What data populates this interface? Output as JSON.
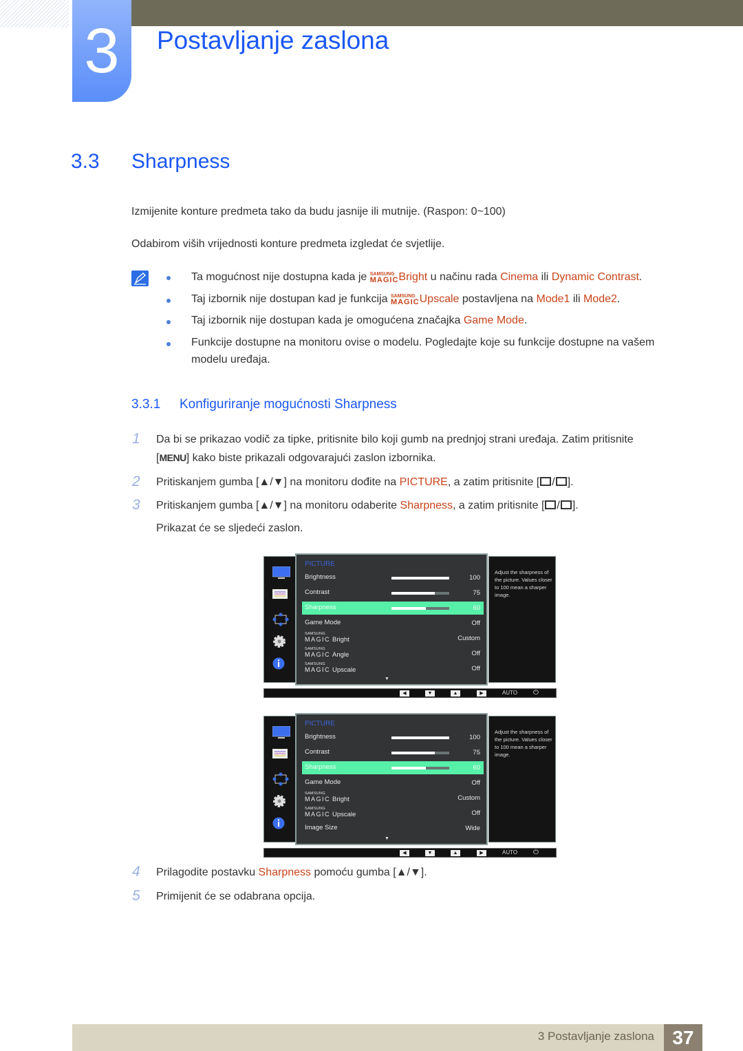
{
  "chapter": {
    "number": "3",
    "title": "Postavljanje zaslona"
  },
  "section": {
    "number": "3.3",
    "title": "Sharpness"
  },
  "intro": [
    "Izmijenite konture predmeta tako da budu jasnije ili mutnije. (Raspon: 0~100)",
    "Odabirom viših vrijednosti konture predmeta izgledat će svjetlije."
  ],
  "magic_logo": {
    "top": "SAMSUNG",
    "bottom": "MAGIC"
  },
  "notes": {
    "n1": {
      "a": "Ta mogućnost nije dostupna kada je ",
      "feature": "Bright",
      "b": " u načinu rada ",
      "c1": "Cinema",
      "d": " ili ",
      "c2": "Dynamic Contrast",
      "e": "."
    },
    "n2": {
      "a": "Taj izbornik nije dostupan kad je funkcija ",
      "feature": "Upscale",
      "b": " postavljena na ",
      "c1": "Mode1",
      "d": " ili ",
      "c2": "Mode2",
      "e": "."
    },
    "n3": {
      "a": "Taj izbornik nije dostupan kada je omogućena značajka ",
      "c1": "Game Mode",
      "e": "."
    },
    "n4": {
      "a": "Funkcije dostupne na monitoru ovise o modelu. Pogledajte koje su funkcije dostupne na vašem",
      "b": "modelu uređaja."
    }
  },
  "subsection": {
    "number": "3.3.1",
    "title": "Konfiguriranje mogućnosti Sharpness"
  },
  "steps": {
    "s1": {
      "num": "1",
      "line1": "Da bi se prikazao vodič za tipke, pritisnite bilo koji gumb na prednjoj strani uređaja. Zatim pritisnite",
      "key": "MENU",
      "line2": "kako biste prikazali odgovarajući zaslon izbornika."
    },
    "s2": {
      "num": "2",
      "a": "Pritiskanjem gumba [",
      "arrows": "▲/▼",
      "b": "] na monitoru dođite na ",
      "hl": "PICTURE",
      "c": ", a zatim pritisnite [",
      "d": "]."
    },
    "s3": {
      "num": "3",
      "a": "Pritiskanjem gumba [",
      "arrows": "▲/▼",
      "b": "] na monitoru odaberite ",
      "hl": "Sharpness",
      "c": ", a zatim pritisnite [",
      "d": "].",
      "line2": "Prikazat će se sljedeći zaslon."
    },
    "s4": {
      "num": "4",
      "a": "Prilagodite postavku ",
      "hl": "Sharpness",
      "b": " pomoću gumba [",
      "arrows": "▲/▼",
      "c": "]."
    },
    "s5": {
      "num": "5",
      "a": "Primijenit će se odabrana opcija."
    }
  },
  "osd1": {
    "title": "PICTURE",
    "rows": [
      {
        "label": "Brightness",
        "value": "100",
        "level": 1.0
      },
      {
        "label": "Contrast",
        "value": "75",
        "level": 0.75
      },
      {
        "label": "Sharpness",
        "value": "60",
        "level": 0.6,
        "selected": true
      },
      {
        "label": "Game Mode",
        "value": "Off"
      },
      {
        "label": "Bright",
        "value": "Custom",
        "magic": true
      },
      {
        "label": "Angle",
        "value": "Off",
        "magic": true
      },
      {
        "label": "Upscale",
        "value": "Off",
        "magic": true
      }
    ],
    "help": "Adjust the sharpness of the picture. Values closer to 100 mean a sharper image.",
    "bottom": {
      "auto": "AUTO"
    }
  },
  "osd2": {
    "title": "PICTURE",
    "rows": [
      {
        "label": "Brightness",
        "value": "100",
        "level": 1.0
      },
      {
        "label": "Contrast",
        "value": "75",
        "level": 0.75
      },
      {
        "label": "Sharpness",
        "value": "60",
        "level": 0.6,
        "selected": true
      },
      {
        "label": "Game Mode",
        "value": "Off"
      },
      {
        "label": "Bright",
        "value": "Custom",
        "magic": true
      },
      {
        "label": "Upscale",
        "value": "Off",
        "magic": true
      },
      {
        "label": "Image Size",
        "value": "Wide"
      }
    ],
    "help": "Adjust the sharpness of the picture. Values closer to 100 mean a sharper image.",
    "bottom": {
      "auto": "AUTO"
    }
  },
  "footer": {
    "text": "3 Postavljanje zaslona",
    "page": "37"
  }
}
